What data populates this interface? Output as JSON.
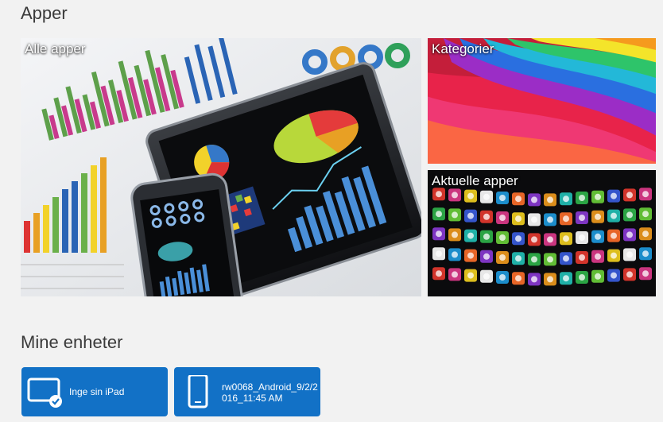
{
  "apps": {
    "title": "Apper",
    "tiles": [
      {
        "label": "Alle apper"
      },
      {
        "label": "Kategorier"
      },
      {
        "label": "Aktuelle apper"
      }
    ]
  },
  "devices": {
    "title": "Mine enheter",
    "items": [
      {
        "label": "Inge sin iPad",
        "icon": "tablet-check-icon"
      },
      {
        "label": "rw0068_Android_9/2/2016_11:45 AM",
        "icon": "phone-icon"
      }
    ]
  },
  "colors": {
    "background": "#f2f2f2",
    "device_button": "#1271c6",
    "title_text": "#3a3a3a"
  }
}
